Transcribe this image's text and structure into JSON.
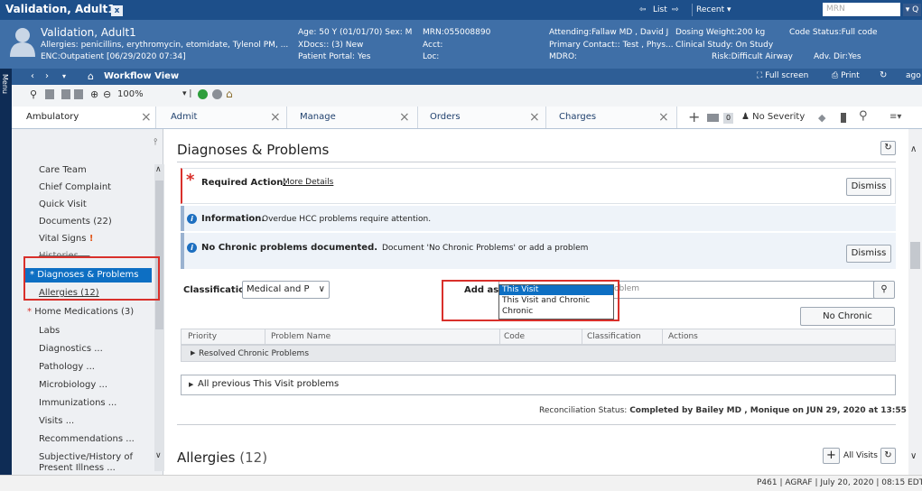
{
  "window": {
    "title": "Validation, Adult1",
    "close": "x"
  },
  "topbar": {
    "list": "List",
    "recent": "Recent",
    "mrn_placeholder": "MRN",
    "search_glyph": "▾ Q"
  },
  "banner": {
    "name": "Validation, Adult1",
    "allergies": "Allergies: penicillins, erythromycin, etomidate, Tylenol PM, ...",
    "enc": "ENC:Outpatient [06/29/2020 07:34]",
    "age": "Age: 50 Y (01/01/70) Sex: M",
    "xdocs": "XDocs:: (3) New",
    "portal": "Patient Portal: Yes",
    "mrn": "MRN:055008890",
    "acct": "Acct:",
    "loc": "Loc:",
    "attending": "Attending:Fallaw MD , David J",
    "primary": "Primary Contact:: Test , Phys...",
    "mdro": "MDRO:",
    "dosing": "Dosing Weight:200 kg",
    "study": "Clinical Study: On Study",
    "risk": "Risk:Difficult Airway",
    "code": "Code Status:Full code",
    "adv": "Adv. Dir:Yes"
  },
  "workflow": {
    "title": "Workflow View",
    "fullscreen": "Full screen",
    "print": "Print",
    "ago": "ago"
  },
  "toolbar": {
    "zoom": "100%"
  },
  "menu": "Menu",
  "tabs": [
    {
      "label": "Ambulatory"
    },
    {
      "label": "Admit"
    },
    {
      "label": "Manage"
    },
    {
      "label": "Orders"
    },
    {
      "label": "Charges"
    }
  ],
  "tab_tools": {
    "badge": "0",
    "severity": "No Severity"
  },
  "sidebar": {
    "items": [
      {
        "label": "Care Team"
      },
      {
        "label": "Chief Complaint"
      },
      {
        "label": "Quick Visit"
      },
      {
        "label": "Documents (22)"
      },
      {
        "label": "Vital Signs"
      },
      {
        "label": "Histories ..."
      },
      {
        "label": "Diagnoses & Problems"
      },
      {
        "label": "Allergies (12)"
      },
      {
        "label": "Home Medications (3)"
      },
      {
        "label": "Labs"
      },
      {
        "label": "Diagnostics ..."
      },
      {
        "label": "Pathology ..."
      },
      {
        "label": "Microbiology ..."
      },
      {
        "label": "Immunizations ..."
      },
      {
        "label": "Visits ..."
      },
      {
        "label": "Recommendations ..."
      },
      {
        "label": "Subjective/History of"
      },
      {
        "label": "Present Illness ..."
      }
    ]
  },
  "main": {
    "title": "Diagnoses & Problems",
    "required": {
      "label": "Required Action.",
      "link": "More Details",
      "dismiss": "Dismiss"
    },
    "info1": {
      "label": "Information.",
      "text": "Overdue HCC problems require attention."
    },
    "info2": {
      "label": "No Chronic problems documented.",
      "text": "Document 'No Chronic Problems' or add a problem",
      "dismiss": "Dismiss"
    },
    "classification": {
      "label": "Classification",
      "value": "Medical and P"
    },
    "add_as": {
      "label": "Add as",
      "options": [
        "This Visit",
        "This Visit and Chronic",
        "Chronic"
      ],
      "search_rest": "oblem"
    },
    "no_chronic_btn": "No Chronic Problems",
    "grid": {
      "columns": [
        "Priority",
        "Problem Name",
        "Code",
        "Classification",
        "Actions"
      ],
      "resolved": "Resolved Chronic Problems"
    },
    "previous": "All previous This Visit problems",
    "reconciliation": {
      "label": "Reconciliation Status:",
      "value": "Completed by Bailey MD , Monique on JUN 29, 2020 at 13:55"
    },
    "allergies": {
      "title": "Allergies",
      "count": "(12)",
      "filter": "All Visits"
    }
  },
  "statusbar": {
    "items": [
      "P461",
      "AGRAF",
      "July 20, 2020",
      "08:15 EDT"
    ]
  }
}
